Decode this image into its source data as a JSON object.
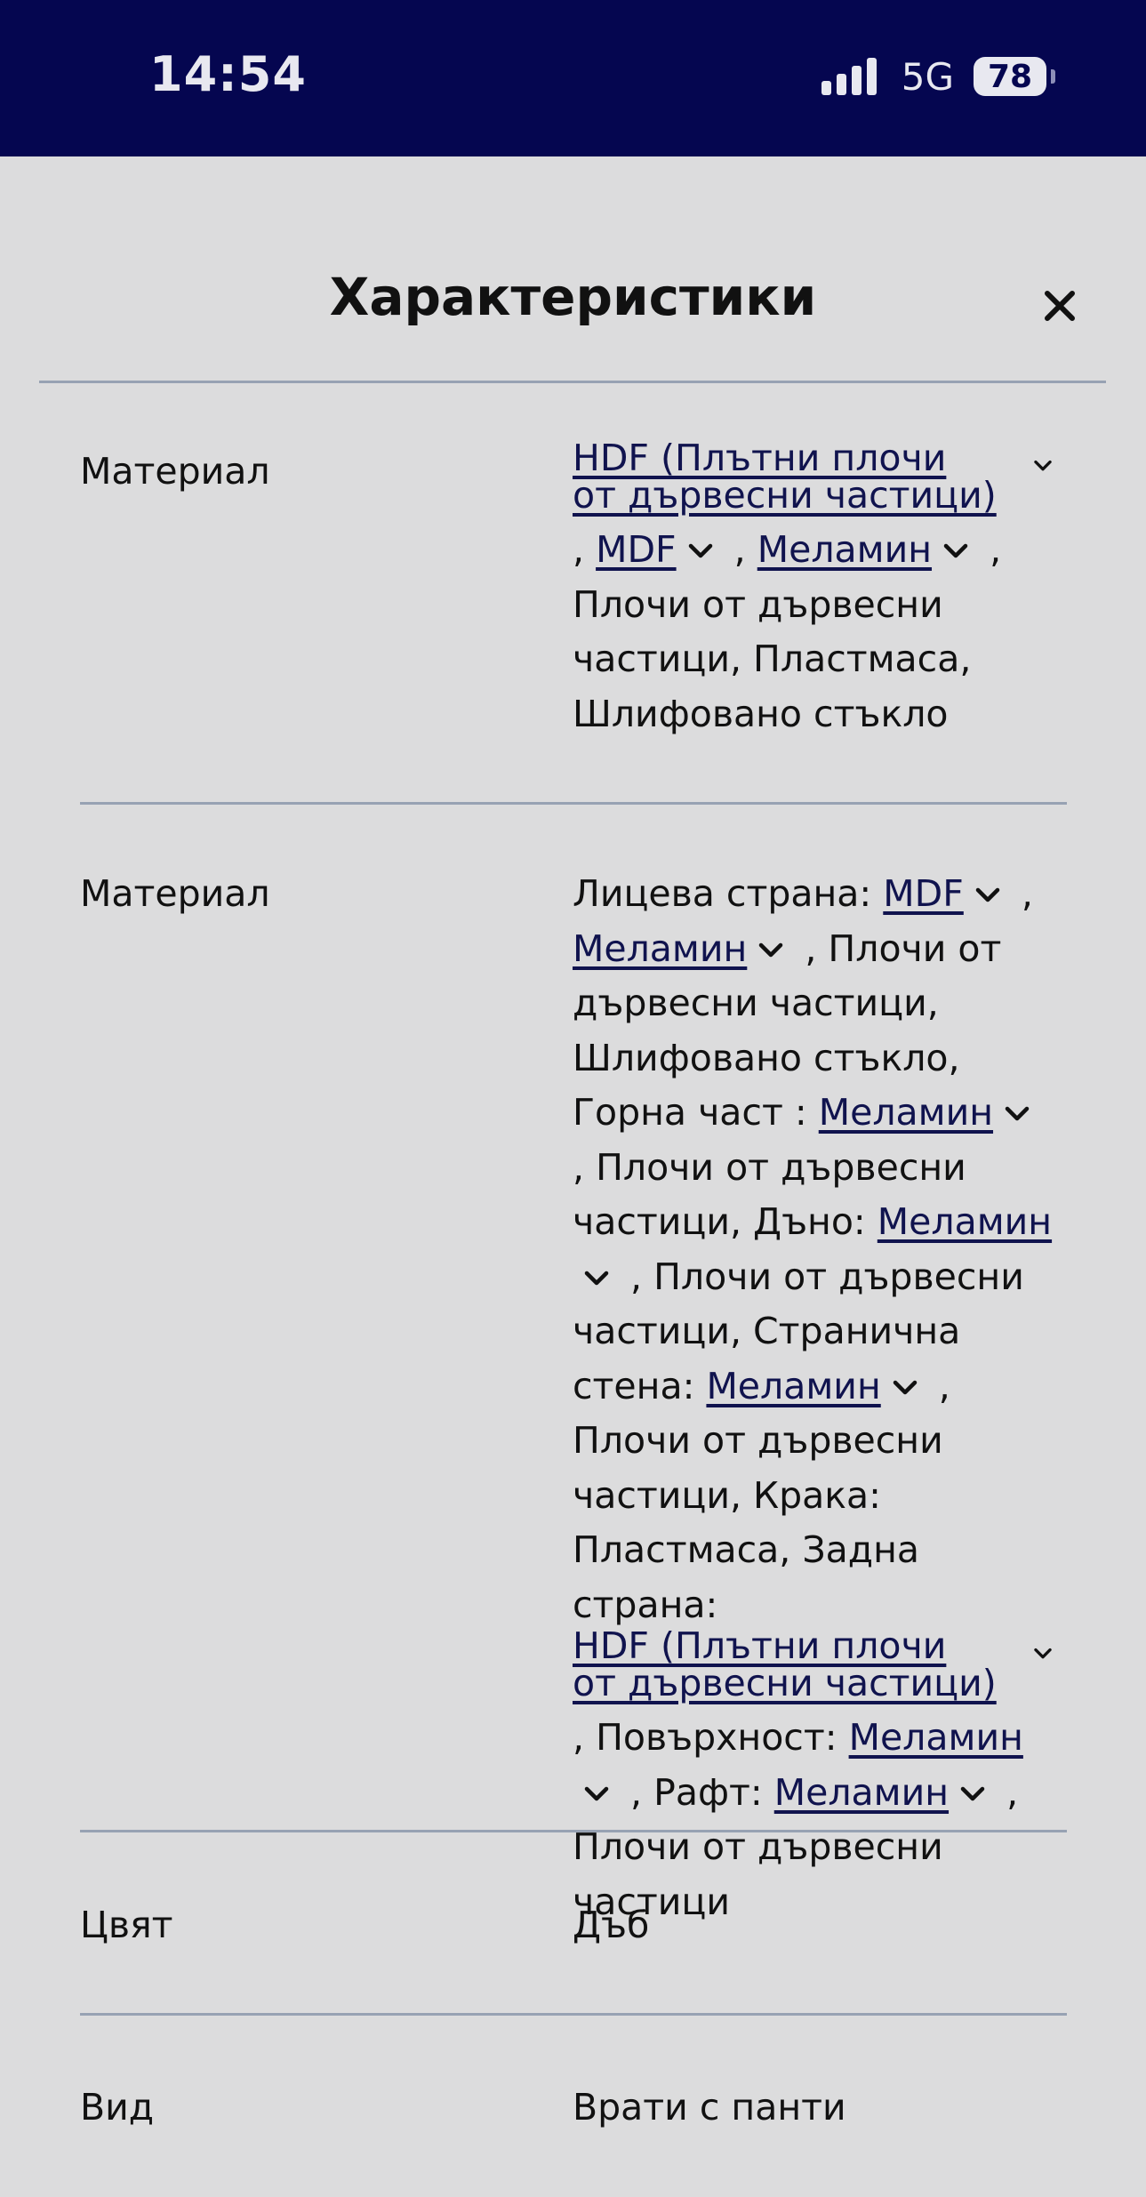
{
  "status_bar": {
    "time": "14:54",
    "network": "5G",
    "battery": "78"
  },
  "sheet": {
    "title": "Характеристики"
  },
  "colors": {
    "status_bar_bg": "#050650",
    "link": "#10134e",
    "divider": "#97a2b3",
    "sheet_bg": "#dcdcdd"
  },
  "rows": [
    {
      "label": "Материал",
      "segments": [
        {
          "type": "block_link",
          "text": "HDF (Плътни плочи от дървесни частици)"
        },
        {
          "type": "text",
          "text": ", "
        },
        {
          "type": "link",
          "text": "MDF"
        },
        {
          "type": "text",
          "text": " , "
        },
        {
          "type": "link",
          "text": "Меламин"
        },
        {
          "type": "text",
          "text": " , Плочи от дървесни частици, Пластмаса, Шлифовано стъкло"
        }
      ]
    },
    {
      "label": "Материал",
      "segments": [
        {
          "type": "text",
          "text": "Лицева страна: "
        },
        {
          "type": "link",
          "text": "MDF"
        },
        {
          "type": "text",
          "text": " , "
        },
        {
          "type": "link",
          "text": "Меламин"
        },
        {
          "type": "text",
          "text": " , Плочи от дървесни частици, Шлифовано стъкло, Горна част : "
        },
        {
          "type": "link",
          "text": "Меламин"
        },
        {
          "type": "text",
          "text": " , Плочи от дървесни частици, Дъно: "
        },
        {
          "type": "link",
          "text": "Меламин"
        },
        {
          "type": "text",
          "text": " , Плочи от дървесни частици, Странична стена: "
        },
        {
          "type": "link",
          "text": "Меламин"
        },
        {
          "type": "text",
          "text": " , Плочи от дървесни частици, Крака: Пластмаса, Задна страна: "
        },
        {
          "type": "block_link",
          "text": "HDF (Плътни плочи от дървесни частици)"
        },
        {
          "type": "text",
          "text": ", Повърхност: "
        },
        {
          "type": "link",
          "text": "Меламин"
        },
        {
          "type": "text",
          "text": " , Рафт: "
        },
        {
          "type": "link",
          "text": "Меламин"
        },
        {
          "type": "text",
          "text": " , Плочи от дървесни частици"
        }
      ]
    },
    {
      "label": "Цвят",
      "segments": [
        {
          "type": "text",
          "text": "Дъб"
        }
      ]
    },
    {
      "label": "Вид",
      "segments": [
        {
          "type": "text",
          "text": "Врати с панти"
        }
      ]
    }
  ]
}
